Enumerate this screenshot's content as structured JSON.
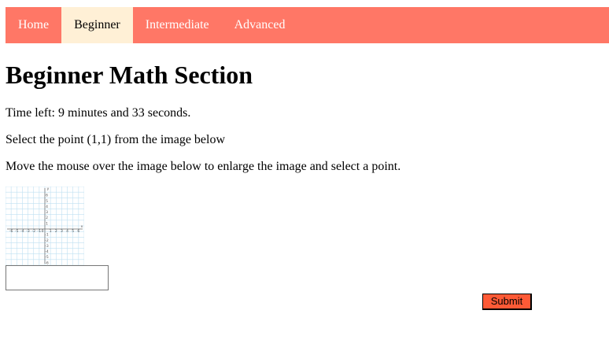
{
  "nav": {
    "items": [
      {
        "label": "Home"
      },
      {
        "label": "Beginner"
      },
      {
        "label": "Intermediate"
      },
      {
        "label": "Advanced"
      }
    ],
    "active_index": 1,
    "bar_color": "#ff7766",
    "active_color": "#fff0d6"
  },
  "main": {
    "title": "Beginner Math Section",
    "timer_text": "Time left: 9 minutes and 33 seconds.",
    "instruction": "Select the point (1,1) from the image below",
    "hint": "Move the mouse over the image below to enlarge the image and select a point."
  },
  "graph": {
    "x_ticks": [
      "-6",
      "-5",
      "-4",
      "-3",
      "-2",
      "-1",
      "1",
      "2",
      "3",
      "4",
      "5",
      "6"
    ],
    "y_ticks": [
      "6",
      "5",
      "4",
      "3",
      "2",
      "1",
      "-1",
      "-2",
      "-3",
      "-4",
      "-5",
      "-6"
    ],
    "origin_label": "0",
    "x_axis_label": "x",
    "y_axis_label": "y",
    "grid_color": "#bfe0f2"
  },
  "form": {
    "answer_value": "",
    "submit_label": "Submit",
    "submit_color": "#ff5a36"
  }
}
